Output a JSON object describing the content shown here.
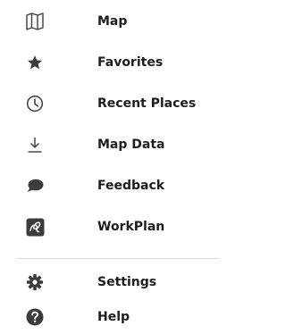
{
  "menu": {
    "items": [
      {
        "label": "Map",
        "icon": "map-icon"
      },
      {
        "label": "Favorites",
        "icon": "star-icon"
      },
      {
        "label": "Recent Places",
        "icon": "clock-icon"
      },
      {
        "label": "Map Data",
        "icon": "download-icon"
      },
      {
        "label": "Feedback",
        "icon": "speech-bubble-icon"
      },
      {
        "label": "WorkPlan",
        "icon": "workplan-icon"
      }
    ],
    "footer_items": [
      {
        "label": "Settings",
        "icon": "gear-icon"
      },
      {
        "label": "Help",
        "icon": "help-icon"
      }
    ]
  },
  "colors": {
    "text": "#1d1d1d",
    "icon": "#3c3c3c",
    "divider": "#dcdcdc"
  }
}
